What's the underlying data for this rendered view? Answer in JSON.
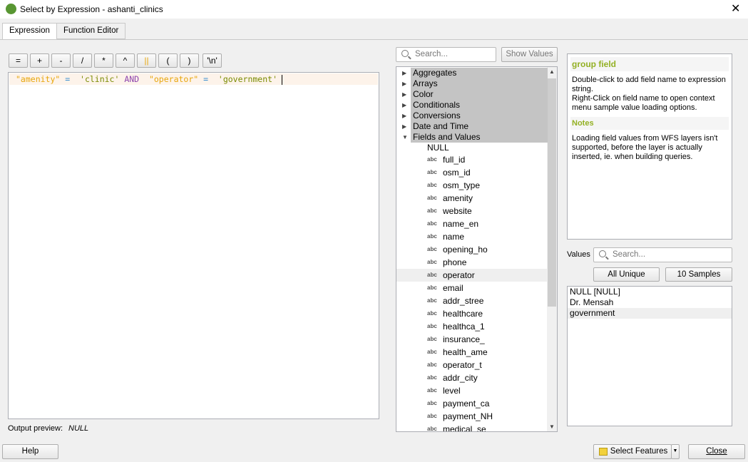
{
  "window": {
    "title": "Select by Expression - ashanti_clinics",
    "logo": "Q"
  },
  "tabs": [
    {
      "label": "Expression",
      "active": true
    },
    {
      "label": "Function Editor",
      "active": false
    }
  ],
  "operators": [
    "=",
    "+",
    "-",
    "/",
    "*",
    "^",
    "||",
    "(",
    ")",
    "'\\n'"
  ],
  "expression": {
    "tokens": [
      {
        "t": "\"amenity\"",
        "c": "f"
      },
      {
        "t": " = ",
        "c": "o"
      },
      {
        "t": " 'clinic'",
        "c": "s"
      },
      {
        "t": " AND ",
        "c": "k"
      },
      {
        "t": " \"operator\"",
        "c": "f"
      },
      {
        "t": " = ",
        "c": "o"
      },
      {
        "t": " 'government'",
        "c": "s"
      }
    ]
  },
  "output_preview": {
    "label": "Output preview:",
    "value": "NULL"
  },
  "function_search": {
    "placeholder": "Search...",
    "show_values": "Show Values"
  },
  "categories": [
    "Aggregates",
    "Arrays",
    "Color",
    "Conditionals",
    "Conversions",
    "Date and Time",
    "Fields and Values"
  ],
  "null_item": "NULL",
  "field_type": "abc",
  "fields": [
    "full_id",
    "osm_id",
    "osm_type",
    "amenity",
    "website",
    "name_en",
    "name",
    "opening_ho",
    "phone",
    "operator",
    "email",
    "addr_stree",
    "healthcare",
    "healthca_1",
    "insurance_",
    "health_ame",
    "operator_t",
    "addr_city",
    "level",
    "payment_ca",
    "payment_NH",
    "medical_se"
  ],
  "selected_field": "operator",
  "help": {
    "title": "group field",
    "text1": "Double-click to add field name to expression string.",
    "text2": "Right-Click on field name to open context menu sample value loading options.",
    "notes_title": "Notes",
    "notes": "Loading field values from WFS layers isn't supported, before the layer is actually inserted, ie. when building queries."
  },
  "values": {
    "label": "Values",
    "placeholder": "Search...",
    "all_unique": "All Unique",
    "samples": "10 Samples",
    "items": [
      "NULL [NULL]",
      "Dr. Mensah",
      "government"
    ],
    "selected": "government"
  },
  "footer": {
    "help": "Help",
    "select_features": "Select Features",
    "close": "Close"
  }
}
